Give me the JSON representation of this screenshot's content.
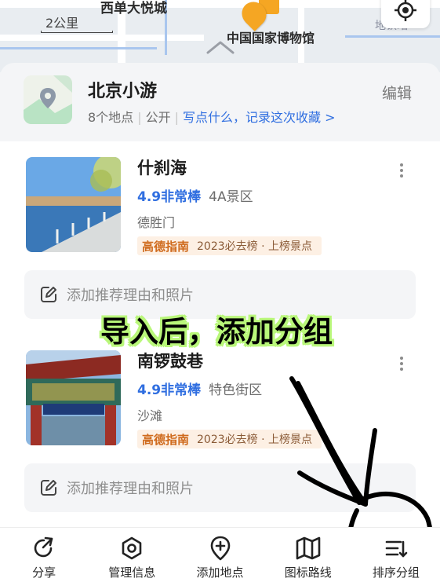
{
  "map": {
    "top_label": "西单大悦城",
    "scale": "2公里",
    "poi_label": "中国国家博物馆",
    "station_hint": "地铁站"
  },
  "header": {
    "title": "北京小游",
    "count": "8个地点",
    "visibility": "公开",
    "note_link": "写点什么，记录这次收藏 >",
    "edit": "编辑"
  },
  "places": [
    {
      "name": "什刹海",
      "score": "4.9",
      "level": "非常棒",
      "tag": "4A景区",
      "area": "德胜门",
      "brand": "高德指南",
      "rank": "2023必去榜 · 上榜景点"
    },
    {
      "name": "南锣鼓巷",
      "score": "4.9",
      "level": "非常棒",
      "tag": "特色街区",
      "area": "沙滩",
      "brand": "高德指南",
      "rank": "2023必去榜 · 上榜景点"
    }
  ],
  "add_reason": "添加推荐理由和照片",
  "annotation": "导入后，添加分组",
  "bottom_bar": [
    {
      "label": "分享",
      "icon": "share-icon"
    },
    {
      "label": "管理信息",
      "icon": "manage-icon"
    },
    {
      "label": "添加地点",
      "icon": "add-location-icon"
    },
    {
      "label": "图标路线",
      "icon": "map-route-icon"
    },
    {
      "label": "排序分组",
      "icon": "sort-group-icon"
    }
  ],
  "colors": {
    "accent_blue": "#2f6ee0",
    "brand_orange": "#cf6a1c",
    "annotation_glow": "#b9f77a"
  }
}
